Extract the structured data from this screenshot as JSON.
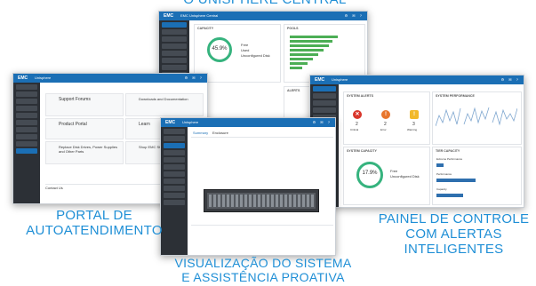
{
  "captions": {
    "top": "O UNISPHERE CENTRAL",
    "left_line1": "PORTAL DE",
    "left_line2": "AUTOATENDIMENTO",
    "right_line1": "PAINEL DE CONTROLE",
    "right_line2": "COM ALERTAS",
    "right_line3": "INTELIGENTES",
    "bottom_line1": "VISUALIZAÇÃO DO SISTEMA",
    "bottom_line2": "E ASSISTÊNCIA PROATIVA"
  },
  "screens": {
    "brand": "EMC",
    "central_title": "EMC Unisphere Central",
    "unisphere_title": "Unisphere",
    "central": {
      "capacity_title": "CAPACITY",
      "capacity_value": "45.9",
      "capacity_unit": "%",
      "legend": [
        "Free",
        "Used",
        "Unconfigured Disk"
      ],
      "pools_title": "POOLS",
      "alerts_title": "ALERTS"
    },
    "portal": {
      "support_title": "Support Forums",
      "downloads_title": "Downloads and Documentation",
      "product_title": "Product Portal",
      "learn_title": "Learn",
      "replace_title": "Replace Disk Drives, Power Supplies and Other Parts",
      "shop_title": "Shop EMC Store",
      "contact_title": "Contact Us"
    },
    "dashboard": {
      "alerts_title": "SYSTEM ALERTS",
      "alert_counts": [
        "2",
        "2",
        "3"
      ],
      "alert_labels": [
        "Critical",
        "Error",
        "Warning"
      ],
      "performance_title": "SYSTEM PERFORMANCE",
      "capacity_title": "SYSTEM CAPACITY",
      "capacity_value": "17.9",
      "capacity_unit": "%",
      "legend": [
        "Free",
        "Unconfigured Disk"
      ],
      "tier_title": "TIER CAPACITY",
      "tiers": [
        "Extreme Performance",
        "Performance",
        "Capacity"
      ]
    },
    "system_view": {
      "tabs": [
        "Summary",
        "Enclosure"
      ],
      "unisphere_title": "Unisphere"
    }
  }
}
